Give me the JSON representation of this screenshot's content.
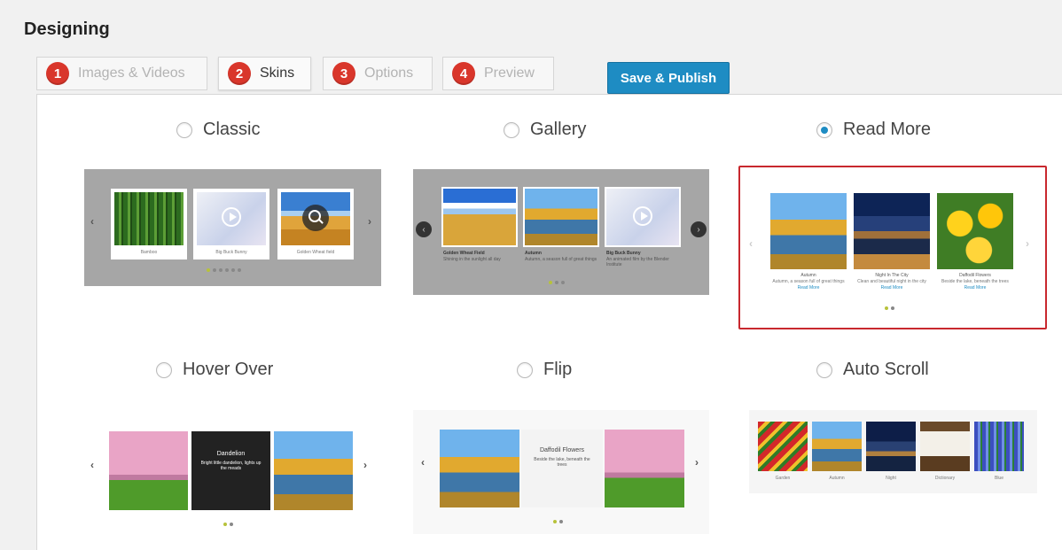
{
  "page": {
    "title": "Designing"
  },
  "steps": [
    {
      "num": "1",
      "label": "Images & Videos",
      "active": false
    },
    {
      "num": "2",
      "label": "Skins",
      "active": true
    },
    {
      "num": "3",
      "label": "Options",
      "active": false
    },
    {
      "num": "4",
      "label": "Preview",
      "active": false
    }
  ],
  "publish": {
    "label": "Save & Publish"
  },
  "skins": {
    "classic": {
      "label": "Classic",
      "checked": false,
      "captions": [
        "Bamboo",
        "Big Buck Bunny",
        "Golden Wheat field"
      ]
    },
    "gallery": {
      "label": "Gallery",
      "checked": false,
      "titles": [
        "Golden Wheat Field",
        "Autumn",
        "Big Buck Bunny"
      ],
      "descs": [
        "Shining in the sunlight all day",
        "Autumn, a season full of great things",
        "An animated film by the Blender Institute"
      ]
    },
    "readmore": {
      "label": "Read More",
      "checked": true,
      "titles": [
        "Autumn",
        "Night In The City",
        "Daffodil Flowers"
      ],
      "descs": [
        "Autumn, a season full of great things",
        "Clean and beautiful night in the city",
        "Beside the lake, beneath the trees"
      ],
      "link": "Read More"
    },
    "hover": {
      "label": "Hover Over",
      "checked": false,
      "title": "Dandelion",
      "desc": "Bright little dandelion, lights up the meads"
    },
    "flip": {
      "label": "Flip",
      "checked": false,
      "title": "Daffodil Flowers",
      "desc": "Beside the lake, beneath the trees"
    },
    "autoscroll": {
      "label": "Auto Scroll",
      "checked": false,
      "captions": [
        "Garden",
        "Autumn",
        "Night",
        "Dictionary",
        "Blue"
      ]
    }
  },
  "colors": {
    "accent": "#1e8cc3",
    "step_badge": "#d9362b",
    "selected_border": "#c8282e"
  }
}
